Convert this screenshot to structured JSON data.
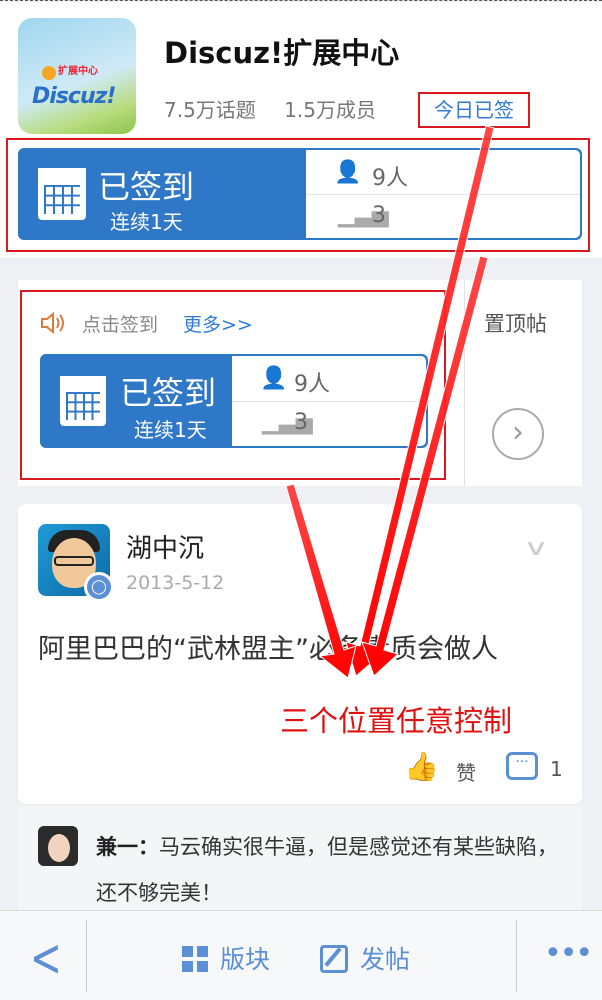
{
  "forum": {
    "title": "Discuz!扩展中心",
    "logo_text_small": "扩展中心",
    "logo_text_main": "Discuz!",
    "topics": "7.5万话题",
    "members": "1.5万成员",
    "today_signed": "今日已签"
  },
  "sign_widget": {
    "status": "已签到",
    "streak": "连续1天",
    "people_count": "9人",
    "rank": "3"
  },
  "sign_section": {
    "click_to_sign": "点击签到",
    "more_link": "更多>>",
    "pinned_label": "置顶帖",
    "next_icon": "›"
  },
  "post": {
    "author": "湖中沉",
    "date": "2013-5-12",
    "body": "阿里巴巴的“武林盟主”必备素质会做人",
    "like_label": "赞",
    "comment_count": "1"
  },
  "reply": {
    "author": "兼一：",
    "text": "马云确实很牛逼，但是感觉还有某些缺陷，还不够完美！"
  },
  "annotation": {
    "text": "三个位置任意控制",
    "color": "#e01010"
  },
  "bottom_bar": {
    "back": "<",
    "boards": "版块",
    "new_post": "发帖",
    "more": "•••"
  },
  "colors": {
    "accent_blue": "#2f78c8",
    "link_blue": "#2f7bd6",
    "highlight_red": "#d9191f"
  }
}
